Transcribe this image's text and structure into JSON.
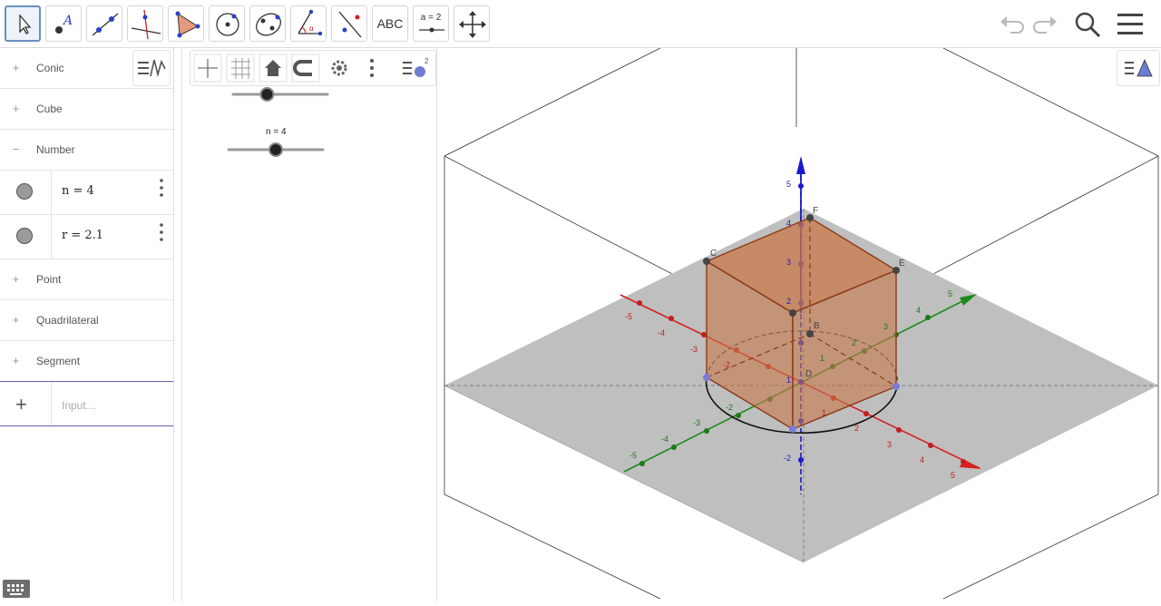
{
  "toolbar": {
    "tools": [
      {
        "id": "move",
        "active": true
      },
      {
        "id": "point",
        "label": ""
      },
      {
        "id": "line"
      },
      {
        "id": "perpendicular"
      },
      {
        "id": "polygon"
      },
      {
        "id": "circle"
      },
      {
        "id": "ellipse"
      },
      {
        "id": "angle"
      },
      {
        "id": "reflect"
      },
      {
        "id": "text",
        "label": "ABC"
      },
      {
        "id": "slider",
        "label": "a = 2"
      },
      {
        "id": "move-view"
      }
    ]
  },
  "algebra": {
    "groups": [
      "Conic",
      "Cube",
      "Number",
      "Point",
      "Quadrilateral",
      "Segment"
    ],
    "number_items": [
      {
        "value": "n = 4"
      },
      {
        "value": "r = 2.1"
      }
    ],
    "input_placeholder": "Input…"
  },
  "graphics2d": {
    "sliders": [
      {
        "label": "",
        "fraction": 0.36
      },
      {
        "label": "n = 4",
        "fraction": 0.5
      }
    ]
  },
  "graphics3d": {
    "points": [
      "C",
      "E",
      "F",
      "B",
      "D"
    ],
    "z_ticks": [
      "5",
      "4",
      "3",
      "2",
      "1",
      "-1",
      "-2"
    ],
    "x_ticks_neg": [
      "-5",
      "-4",
      "-3",
      "-2",
      "-1"
    ],
    "x_ticks_pos": [
      "1",
      "2",
      "3",
      "4",
      "5"
    ],
    "y_ticks_pos": [
      "1",
      "2",
      "3",
      "4",
      "5"
    ],
    "y_ticks_neg": [
      "-1",
      "-2",
      "-3",
      "-4",
      "-5"
    ],
    "colors": {
      "cube_fill": "#c8784a",
      "cube_edge": "#8b3a1a",
      "x_axis": "#d62020",
      "y_axis": "#1a8a1a",
      "z_axis": "#1a1acc",
      "plane": "#bfbfbf"
    }
  }
}
